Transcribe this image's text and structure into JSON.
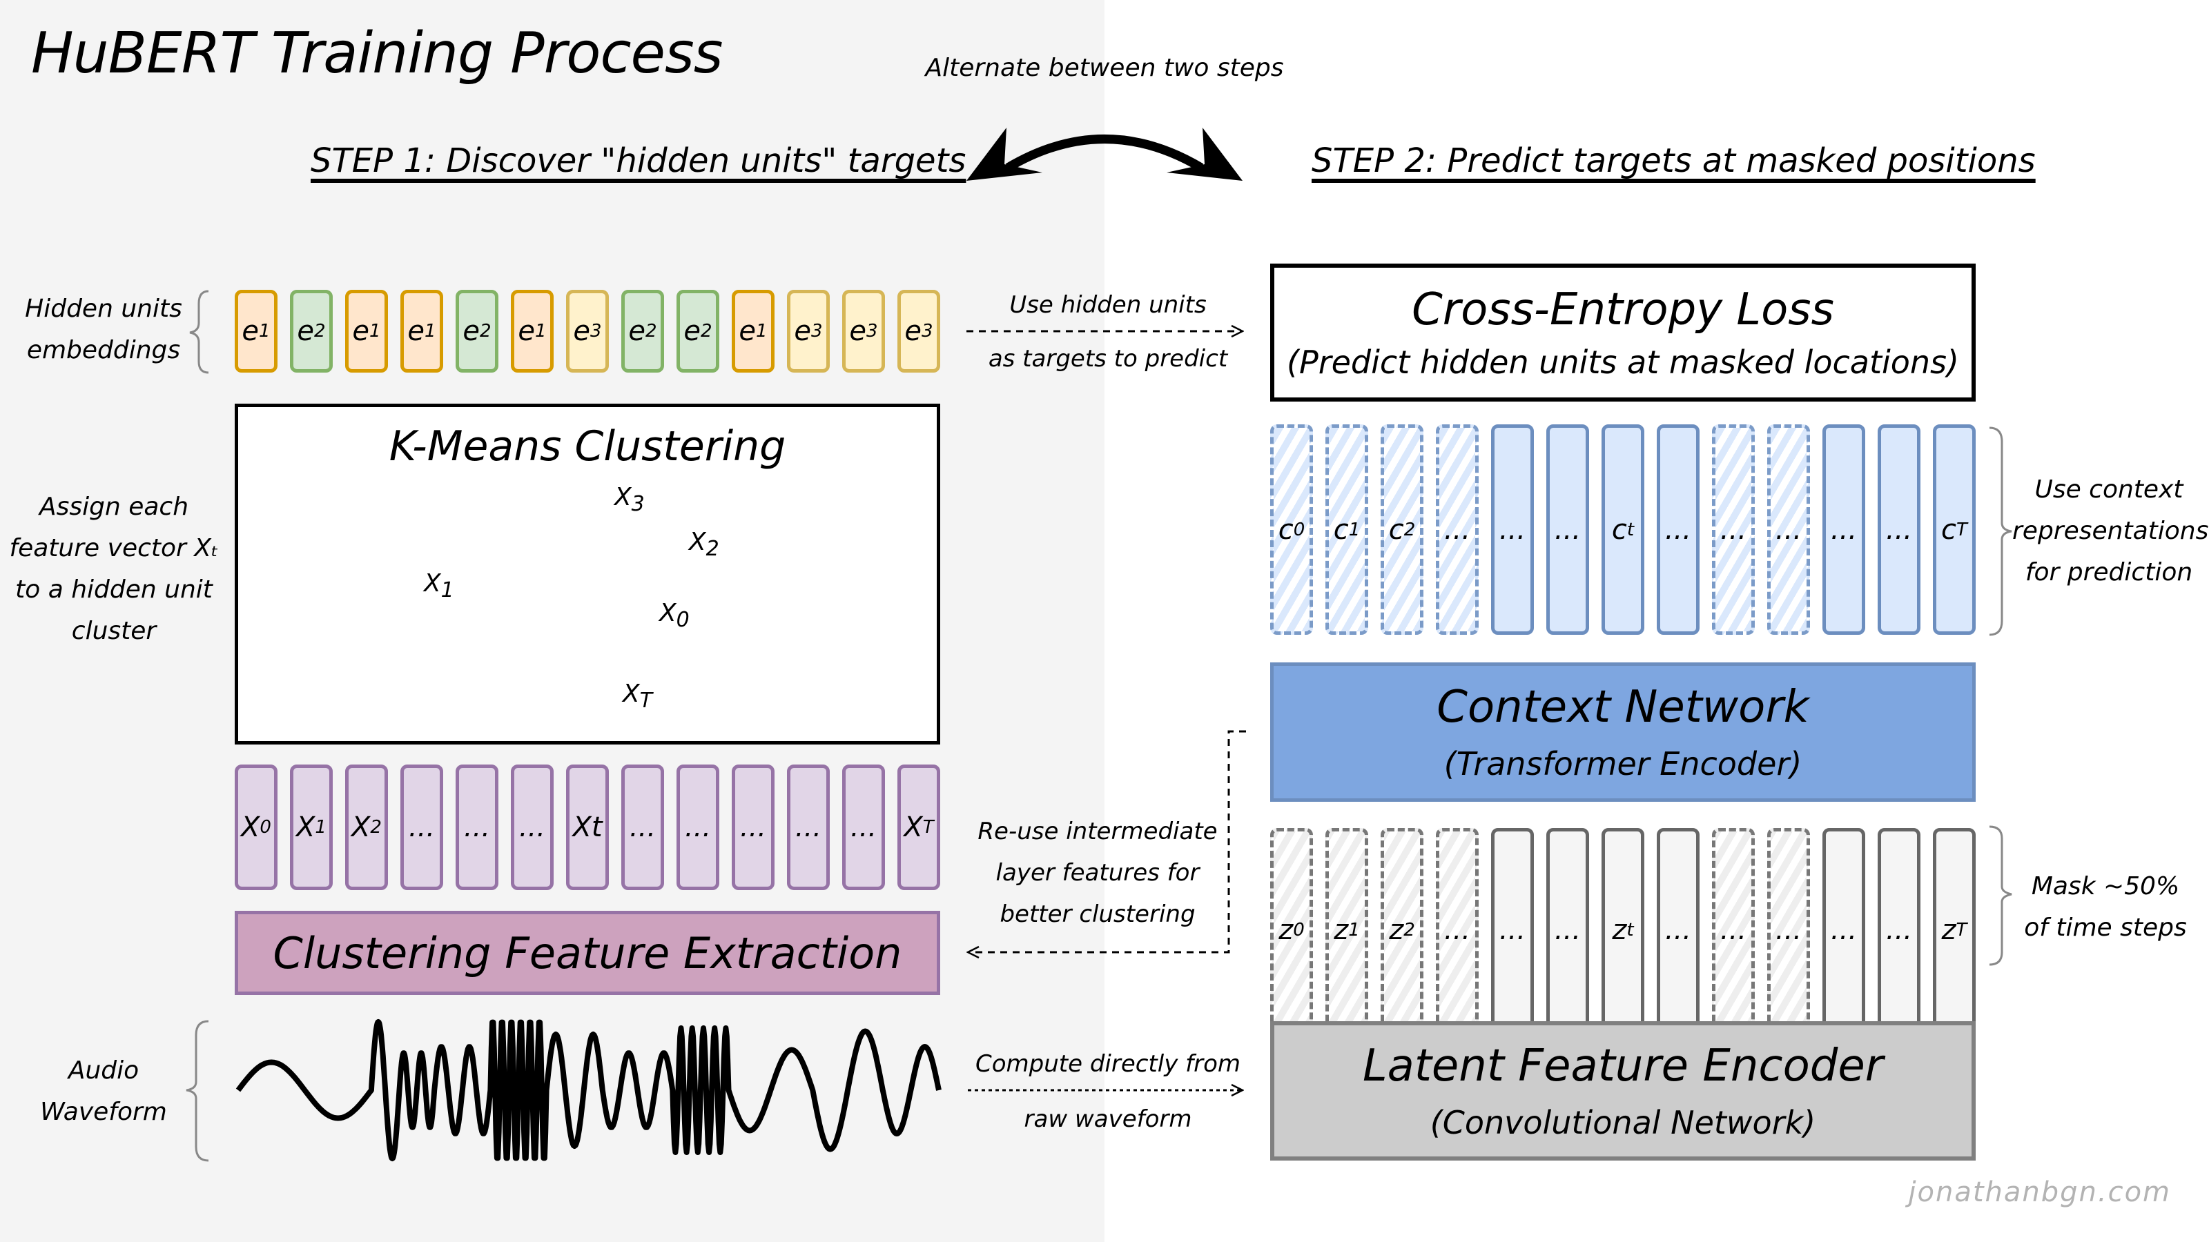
{
  "title": "HuBERT Training Process",
  "alternate_label": "Alternate between two steps",
  "step1": {
    "title": "STEP 1: Discover \"hidden units\" targets",
    "hidden_units_label": [
      "Hidden units",
      "embeddings"
    ],
    "hidden_units": [
      {
        "label": "e",
        "sub": "1",
        "cluster": "e1"
      },
      {
        "label": "e",
        "sub": "2",
        "cluster": "e2"
      },
      {
        "label": "e",
        "sub": "1",
        "cluster": "e1"
      },
      {
        "label": "e",
        "sub": "1",
        "cluster": "e1"
      },
      {
        "label": "e",
        "sub": "2",
        "cluster": "e2"
      },
      {
        "label": "e",
        "sub": "1",
        "cluster": "e1"
      },
      {
        "label": "e",
        "sub": "3",
        "cluster": "e3"
      },
      {
        "label": "e",
        "sub": "2",
        "cluster": "e2"
      },
      {
        "label": "e",
        "sub": "2",
        "cluster": "e2"
      },
      {
        "label": "e",
        "sub": "1",
        "cluster": "e1"
      },
      {
        "label": "e",
        "sub": "3",
        "cluster": "e3"
      },
      {
        "label": "e",
        "sub": "3",
        "cluster": "e3"
      },
      {
        "label": "e",
        "sub": "3",
        "cluster": "e3"
      }
    ],
    "kmeans": {
      "title": "K-Means Clustering",
      "side_label": [
        "Assign each",
        "feature vector Xₜ",
        "to a hidden unit",
        "cluster"
      ],
      "point_labels": [
        {
          "label": "X",
          "sub": "3"
        },
        {
          "label": "X",
          "sub": "2"
        },
        {
          "label": "X",
          "sub": "1"
        },
        {
          "label": "X",
          "sub": "0"
        },
        {
          "label": "X",
          "sub": "T"
        }
      ]
    },
    "features": [
      {
        "label": "X",
        "sub": "0"
      },
      {
        "label": "X",
        "sub": "1"
      },
      {
        "label": "X",
        "sub": "2"
      },
      {
        "label": "...",
        "sub": ""
      },
      {
        "label": "...",
        "sub": ""
      },
      {
        "label": "...",
        "sub": ""
      },
      {
        "label": "Xt",
        "sub": ""
      },
      {
        "label": "...",
        "sub": ""
      },
      {
        "label": "...",
        "sub": ""
      },
      {
        "label": "...",
        "sub": ""
      },
      {
        "label": "...",
        "sub": ""
      },
      {
        "label": "...",
        "sub": ""
      },
      {
        "label": "X",
        "sub": "T"
      }
    ],
    "feature_extraction_label": "Clustering Feature Extraction",
    "waveform_label": [
      "Audio",
      "Waveform"
    ]
  },
  "middle": {
    "use_hidden_units": [
      "Use hidden units",
      "as targets to predict"
    ],
    "reuse_features": [
      "Re-use intermediate",
      "layer features for",
      "better clustering"
    ],
    "compute_from_raw": [
      "Compute directly from",
      "raw waveform"
    ]
  },
  "step2": {
    "title": "STEP 2: Predict targets at masked positions",
    "loss": {
      "title": "Cross-Entropy Loss",
      "subtitle": "(Predict hidden units at masked locations)"
    },
    "context_cells": [
      {
        "label": "c",
        "sub": "0",
        "masked": true
      },
      {
        "label": "c",
        "sub": "1",
        "masked": true
      },
      {
        "label": "c",
        "sub": "2",
        "masked": true
      },
      {
        "label": "...",
        "sub": "",
        "masked": true
      },
      {
        "label": "...",
        "sub": "",
        "masked": false
      },
      {
        "label": "...",
        "sub": "",
        "masked": false
      },
      {
        "label": "c",
        "sub": "t",
        "masked": false
      },
      {
        "label": "...",
        "sub": "",
        "masked": false
      },
      {
        "label": "...",
        "sub": "",
        "masked": true
      },
      {
        "label": "...",
        "sub": "",
        "masked": true
      },
      {
        "label": "...",
        "sub": "",
        "masked": false
      },
      {
        "label": "...",
        "sub": "",
        "masked": false
      },
      {
        "label": "c",
        "sub": "T",
        "masked": false
      }
    ],
    "context_side_label": [
      "Use context",
      "representations",
      "for prediction"
    ],
    "context_network": {
      "title": "Context Network",
      "subtitle": "(Transformer Encoder)"
    },
    "latent_cells": [
      {
        "label": "z",
        "sub": "0",
        "masked": true
      },
      {
        "label": "z",
        "sub": "1",
        "masked": true
      },
      {
        "label": "z",
        "sub": "2",
        "masked": true
      },
      {
        "label": "...",
        "sub": "",
        "masked": true
      },
      {
        "label": "...",
        "sub": "",
        "masked": false
      },
      {
        "label": "...",
        "sub": "",
        "masked": false
      },
      {
        "label": "z",
        "sub": "t",
        "masked": false
      },
      {
        "label": "...",
        "sub": "",
        "masked": false
      },
      {
        "label": "...",
        "sub": "",
        "masked": true
      },
      {
        "label": "...",
        "sub": "",
        "masked": true
      },
      {
        "label": "...",
        "sub": "",
        "masked": false
      },
      {
        "label": "...",
        "sub": "",
        "masked": false
      },
      {
        "label": "z",
        "sub": "T",
        "masked": false
      }
    ],
    "mask_side_label": [
      "Mask ~50%",
      "of time steps"
    ],
    "latent_encoder": {
      "title": "Latent Feature Encoder",
      "subtitle": "(Convolutional Network)"
    }
  },
  "colors": {
    "left_panel_bg": "#f4f4f4",
    "e1_fill": "#ffe6cc",
    "e1_stroke": "#d79b00",
    "e2_fill": "#d5e8d4",
    "e2_stroke": "#82b366",
    "e3_fill": "#fff2cc",
    "e3_stroke": "#d6b656",
    "feature_fill": "#e1d5e7",
    "feature_stroke": "#9673a6",
    "extraction_fill": "#cda2be",
    "context_fill": "#dae8fc",
    "context_stroke": "#6c8ebf",
    "context_network_fill": "#7ea6e0",
    "latent_fill": "#f5f5f5",
    "latent_stroke": "#666666",
    "encoder_fill": "#cccccc",
    "encoder_stroke": "#808080"
  },
  "watermark": "jonathanbgn.com"
}
